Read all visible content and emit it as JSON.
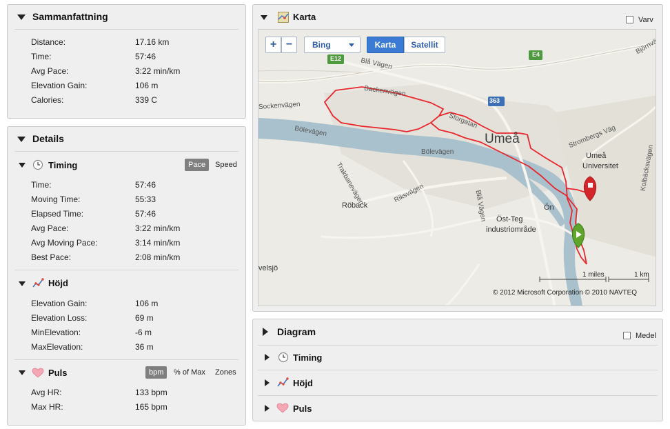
{
  "summary": {
    "title": "Sammanfattning",
    "rows": [
      {
        "label": "Distance:",
        "value": "17.16 km"
      },
      {
        "label": "Time:",
        "value": "57:46"
      },
      {
        "label": "Avg Pace:",
        "value": "3:22 min/km"
      },
      {
        "label": "Elevation Gain:",
        "value": "106 m"
      },
      {
        "label": "Calories:",
        "value": "339 C"
      }
    ]
  },
  "details": {
    "title": "Details",
    "timing": {
      "title": "Timing",
      "toggles": [
        "Pace",
        "Speed"
      ],
      "rows": [
        {
          "label": "Time:",
          "value": "57:46"
        },
        {
          "label": "Moving Time:",
          "value": "55:33"
        },
        {
          "label": "Elapsed Time:",
          "value": "57:46"
        },
        {
          "label": "Avg Pace:",
          "value": "3:22 min/km"
        },
        {
          "label": "Avg Moving Pace:",
          "value": "3:14 min/km"
        },
        {
          "label": "Best Pace:",
          "value": "2:08 min/km"
        }
      ]
    },
    "elevation": {
      "title": "Höjd",
      "rows": [
        {
          "label": "Elevation Gain:",
          "value": "106 m"
        },
        {
          "label": "Elevation Loss:",
          "value": "69 m"
        },
        {
          "label": "MinElevation:",
          "value": "-6 m"
        },
        {
          "label": "MaxElevation:",
          "value": "36 m"
        }
      ]
    },
    "pulse": {
      "title": "Puls",
      "toggles": [
        "bpm",
        "% of Max",
        "Zones"
      ],
      "rows": [
        {
          "label": "Avg HR:",
          "value": "133 bpm"
        },
        {
          "label": "Max HR:",
          "value": "165 bpm"
        }
      ]
    }
  },
  "map": {
    "title": "Karta",
    "laps_label": "Varv",
    "zoom_in": "+",
    "zoom_out": "−",
    "provider": "Bing",
    "view_map": "Karta",
    "view_satellite": "Satellit",
    "places": {
      "umea": "Umeå",
      "univ1": "Umeå",
      "univ2": "Universitet",
      "roback": "Röback",
      "on": "Ön",
      "ost1": "Öst-Teg",
      "ost2": "industriområde",
      "velsjo": "velsjö",
      "e12": "E12",
      "e4": "E4",
      "r363": "363",
      "bla": "Blå Vägen",
      "backen": "Backenvägen",
      "sockenv": "Sockenvägen",
      "bolev1": "Bölevägen",
      "bolev2": "Bölevägen",
      "storg": "Storgatan",
      "rik": "Riksvägen",
      "trak": "Trakbanevägen",
      "stromb": "Strombergs Väg",
      "blav2": "Blå Vägen",
      "kolb": "Kolbäcksvägen",
      "bjorn": "Björnvägen"
    },
    "scale_miles": "1 miles",
    "scale_km": "1 km",
    "copyright": "© 2012 Microsoft Corporation  © 2010 NAVTEQ"
  },
  "diagram": {
    "title": "Diagram",
    "avg_label": "Medel",
    "items": [
      "Timing",
      "Höjd",
      "Puls"
    ]
  },
  "colors": {
    "route": "#e8262b",
    "water": "#a9c1cd",
    "map_land": "#ecebe6",
    "map_button_active": "#3b7bd4",
    "toggle_active": "#7f7f7f"
  }
}
